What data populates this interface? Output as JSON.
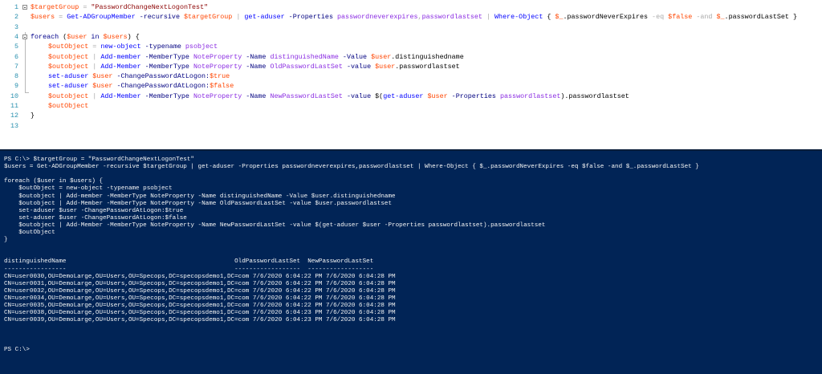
{
  "editor": {
    "lines": [
      {
        "num": "1",
        "parts": [
          {
            "t": "$targetGroup",
            "c": "var"
          },
          {
            "t": " = ",
            "c": "op"
          },
          {
            "t": "\"PasswordChangeNextLogonTest\"",
            "c": "str"
          }
        ]
      },
      {
        "num": "2",
        "parts": [
          {
            "t": "$users",
            "c": "var"
          },
          {
            "t": " = ",
            "c": "op"
          },
          {
            "t": "Get-ADGroupMember",
            "c": "cmd"
          },
          {
            "t": " -recursive ",
            "c": "param"
          },
          {
            "t": "$targetGroup",
            "c": "var"
          },
          {
            "t": " | ",
            "c": "op"
          },
          {
            "t": "get-aduser",
            "c": "cmd"
          },
          {
            "t": " -Properties ",
            "c": "param"
          },
          {
            "t": "passwordneverexpires",
            "c": "arg"
          },
          {
            "t": ",",
            "c": "op"
          },
          {
            "t": "passwordlastset",
            "c": "arg"
          },
          {
            "t": " | ",
            "c": "op"
          },
          {
            "t": "Where-Object",
            "c": "cmd"
          },
          {
            "t": " { ",
            "c": "grp"
          },
          {
            "t": "$_",
            "c": "var"
          },
          {
            "t": ".passwordNeverExpires",
            "c": "mem"
          },
          {
            "t": " -eq ",
            "c": "op"
          },
          {
            "t": "$false",
            "c": "var"
          },
          {
            "t": " -and ",
            "c": "op"
          },
          {
            "t": "$_",
            "c": "var"
          },
          {
            "t": ".passwordLastSet",
            "c": "mem"
          },
          {
            "t": " }",
            "c": "grp"
          }
        ]
      },
      {
        "num": "3",
        "parts": []
      },
      {
        "num": "4",
        "parts": [
          {
            "t": "foreach",
            "c": "kw"
          },
          {
            "t": " (",
            "c": "grp"
          },
          {
            "t": "$user",
            "c": "var"
          },
          {
            "t": " in ",
            "c": "kw"
          },
          {
            "t": "$users",
            "c": "var"
          },
          {
            "t": ") {",
            "c": "grp"
          }
        ]
      },
      {
        "num": "5",
        "indent": true,
        "parts": [
          {
            "t": "$outObject",
            "c": "var"
          },
          {
            "t": " = ",
            "c": "op"
          },
          {
            "t": "new-object",
            "c": "cmd"
          },
          {
            "t": " -typename ",
            "c": "param"
          },
          {
            "t": "psobject",
            "c": "arg"
          }
        ]
      },
      {
        "num": "6",
        "indent": true,
        "parts": [
          {
            "t": "$outobject",
            "c": "var"
          },
          {
            "t": " | ",
            "c": "op"
          },
          {
            "t": "Add-member",
            "c": "cmd"
          },
          {
            "t": " -MemberType ",
            "c": "param"
          },
          {
            "t": "NoteProperty",
            "c": "arg"
          },
          {
            "t": " -Name ",
            "c": "param"
          },
          {
            "t": "distinguishedName",
            "c": "arg"
          },
          {
            "t": " -Value ",
            "c": "param"
          },
          {
            "t": "$user",
            "c": "var"
          },
          {
            "t": ".distinguishedname",
            "c": "mem"
          }
        ]
      },
      {
        "num": "7",
        "indent": true,
        "parts": [
          {
            "t": "$outobject",
            "c": "var"
          },
          {
            "t": " | ",
            "c": "op"
          },
          {
            "t": "Add-Member",
            "c": "cmd"
          },
          {
            "t": " -MemberType ",
            "c": "param"
          },
          {
            "t": "NoteProperty",
            "c": "arg"
          },
          {
            "t": " -Name ",
            "c": "param"
          },
          {
            "t": "OldPasswordLastSet",
            "c": "arg"
          },
          {
            "t": " -value ",
            "c": "param"
          },
          {
            "t": "$user",
            "c": "var"
          },
          {
            "t": ".passwordlastset",
            "c": "mem"
          }
        ]
      },
      {
        "num": "8",
        "indent": true,
        "parts": [
          {
            "t": "set-aduser",
            "c": "cmd"
          },
          {
            "t": " ",
            "c": "txt"
          },
          {
            "t": "$user",
            "c": "var"
          },
          {
            "t": " -ChangePasswordAtLogon:",
            "c": "param"
          },
          {
            "t": "$true",
            "c": "var"
          }
        ]
      },
      {
        "num": "9",
        "indent": true,
        "parts": [
          {
            "t": "set-aduser",
            "c": "cmd"
          },
          {
            "t": " ",
            "c": "txt"
          },
          {
            "t": "$user",
            "c": "var"
          },
          {
            "t": " -ChangePasswordAtLogon:",
            "c": "param"
          },
          {
            "t": "$false",
            "c": "var"
          }
        ]
      },
      {
        "num": "10",
        "indent": true,
        "parts": [
          {
            "t": "$outobject",
            "c": "var"
          },
          {
            "t": " | ",
            "c": "op"
          },
          {
            "t": "Add-Member",
            "c": "cmd"
          },
          {
            "t": " -MemberType ",
            "c": "param"
          },
          {
            "t": "NoteProperty",
            "c": "arg"
          },
          {
            "t": " -Name ",
            "c": "param"
          },
          {
            "t": "NewPasswordLastSet",
            "c": "arg"
          },
          {
            "t": " -value ",
            "c": "param"
          },
          {
            "t": "$(",
            "c": "grp"
          },
          {
            "t": "get-aduser",
            "c": "cmd"
          },
          {
            "t": " ",
            "c": "txt"
          },
          {
            "t": "$user",
            "c": "var"
          },
          {
            "t": " -Properties ",
            "c": "param"
          },
          {
            "t": "passwordlastset",
            "c": "arg"
          },
          {
            "t": ")",
            "c": "grp"
          },
          {
            "t": ".passwordlastset",
            "c": "mem"
          }
        ]
      },
      {
        "num": "11",
        "indent": true,
        "parts": [
          {
            "t": "$outObject",
            "c": "var"
          }
        ]
      },
      {
        "num": "12",
        "parts": [
          {
            "t": "}",
            "c": "grp"
          }
        ]
      },
      {
        "num": "13",
        "parts": []
      }
    ]
  },
  "console": {
    "lines": [
      "PS C:\\> $targetGroup = \"PasswordChangeNextLogonTest\"",
      "$users = Get-ADGroupMember -recursive $targetGroup | get-aduser -Properties passwordneverexpires,passwordlastset | Where-Object { $_.passwordNeverExpires -eq $false -and $_.passwordLastSet }",
      "",
      "foreach ($user in $users) {",
      "    $outObject = new-object -typename psobject",
      "    $outobject | Add-member -MemberType NoteProperty -Name distinguishedName -Value $user.distinguishedname",
      "    $outobject | Add-Member -MemberType NoteProperty -Name OldPasswordLastSet -value $user.passwordlastset",
      "    set-aduser $user -ChangePasswordAtLogon:$true",
      "    set-aduser $user -ChangePasswordAtLogon:$false",
      "    $outobject | Add-Member -MemberType NoteProperty -Name NewPasswordLastSet -value $(get-aduser $user -Properties passwordlastset).passwordlastset",
      "    $outObject",
      "}",
      "",
      "",
      "distinguishedName                                              OldPasswordLastSet  NewPasswordLastSet",
      "-----------------                                              ------------------  ------------------",
      "CN=user0030,OU=DemoLarge,OU=Users,OU=Specops,DC=specopsdemo1,DC=com 7/6/2020 6:04:22 PM 7/6/2020 6:04:28 PM",
      "CN=user0031,OU=DemoLarge,OU=Users,OU=Specops,DC=specopsdemo1,DC=com 7/6/2020 6:04:22 PM 7/6/2020 6:04:28 PM",
      "CN=user0032,OU=DemoLarge,OU=Users,OU=Specops,DC=specopsdemo1,DC=com 7/6/2020 6:04:22 PM 7/6/2020 6:04:28 PM",
      "CN=user0034,OU=DemoLarge,OU=Users,OU=Specops,DC=specopsdemo1,DC=com 7/6/2020 6:04:22 PM 7/6/2020 6:04:28 PM",
      "CN=user0035,OU=DemoLarge,OU=Users,OU=Specops,DC=specopsdemo1,DC=com 7/6/2020 6:04:22 PM 7/6/2020 6:04:28 PM",
      "CN=user0038,OU=DemoLarge,OU=Users,OU=Specops,DC=specopsdemo1,DC=com 7/6/2020 6:04:23 PM 7/6/2020 6:04:28 PM",
      "CN=user0039,OU=DemoLarge,OU=Users,OU=Specops,DC=specopsdemo1,DC=com 7/6/2020 6:04:23 PM 7/6/2020 6:04:28 PM",
      "",
      "",
      "",
      "PS C:\\>"
    ]
  }
}
